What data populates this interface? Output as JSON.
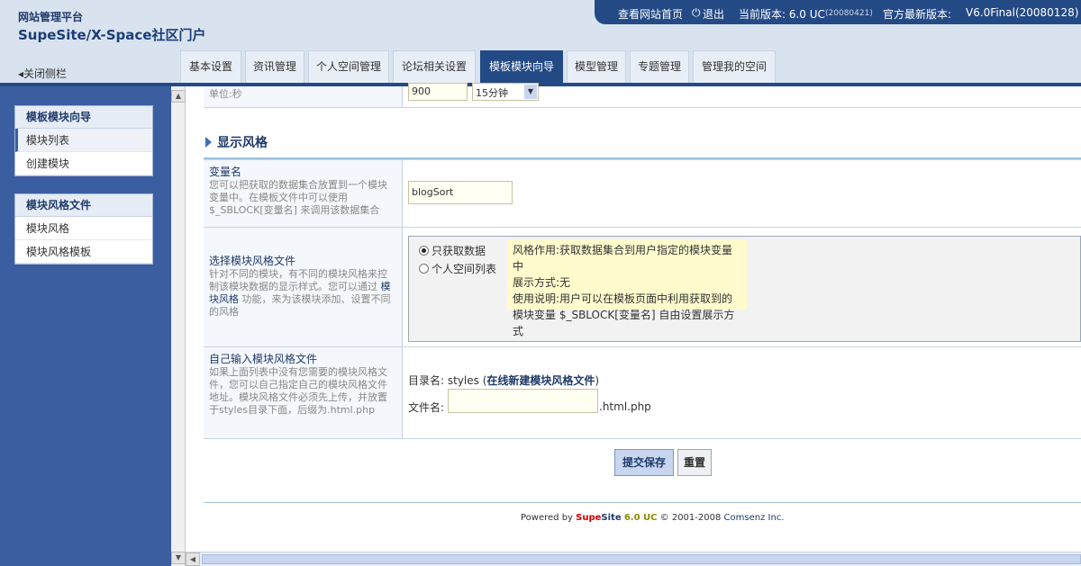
{
  "header": {
    "brand_small": "网站管理平台",
    "brand_big": "SupeSite/X-Space社区门户",
    "close_sidebar": "◂关闭侧栏",
    "view_home": "查看网站首页",
    "logout": "退出",
    "current_version_label": "当前版本: 6.0 UC",
    "current_version_date": "(20080421)",
    "latest_version_label": "官方最新版本:",
    "latest_version": "V6.0Final(20080128)"
  },
  "tabs": [
    {
      "label": "基本设置"
    },
    {
      "label": "资讯管理"
    },
    {
      "label": "个人空间管理"
    },
    {
      "label": "论坛相关设置"
    },
    {
      "label": "模板模块向导",
      "active": true
    },
    {
      "label": "模型管理"
    },
    {
      "label": "专题管理"
    },
    {
      "label": "管理我的空间"
    }
  ],
  "sidebar": {
    "box1": {
      "title": "模板模块向导",
      "items": [
        "模块列表",
        "创建模块"
      ]
    },
    "box2": {
      "title": "模块风格文件",
      "items": [
        "模块风格",
        "模块风格模板"
      ]
    }
  },
  "top_row": {
    "label": "单位:秒",
    "input_value": "900",
    "select_value": "15分钟"
  },
  "section": {
    "title": "显示风格"
  },
  "var_row": {
    "title": "变量名",
    "desc": "您可以把获取的数据集合放置到一个模块变量中。在模板文件中可以使用 $_SBLOCK[变量名] 来调用该数据集合",
    "value": "blogSort"
  },
  "style_row": {
    "title": "选择模块风格文件",
    "desc_a": "针对不同的模块，有不同的模块风格来控制该模块数据的显示样式。您可以通过",
    "desc_link": "模块风格",
    "desc_b": "功能，来为该模块添加、设置不同的风格",
    "options": [
      {
        "label": "只获取数据",
        "checked": true
      },
      {
        "label": "个人空间列表",
        "checked": false
      }
    ],
    "tip": [
      "风格作用:获取数据集合到用户指定的模块变量中",
      "展示方式:无",
      "使用说明:用户可以在模板页面中利用获取到的",
      "模块变量 $_SBLOCK[变量名] 自由设置展示方式"
    ]
  },
  "custom_row": {
    "title": "自己输入模块风格文件",
    "desc": "如果上面列表中没有您需要的模块风格文件，您可以自己指定自己的模块风格文件地址。模块风格文件必须先上传，并放置于styles目录下面，后缀为.html.php",
    "dir_label": "目录名: styles (",
    "dir_link": "在线新建模块风格文件",
    "dir_close": ")",
    "file_label": "文件名:",
    "file_value": "",
    "file_suffix": ".html.php"
  },
  "buttons": {
    "submit": "提交保存",
    "reset": "重置"
  },
  "footer": {
    "powered": "Powered by",
    "supe": "Supe",
    "site": "Site",
    "version": "6.0 UC",
    "copy": "© 2001-2008",
    "company": "Comsenz Inc."
  },
  "colors": {
    "brand_blue": "#244a86",
    "sidebar_blue": "#3b5ea0",
    "tip_yellow": "#fffbcc",
    "supe_red": "#d40000",
    "version_olive": "#8a8a00"
  }
}
